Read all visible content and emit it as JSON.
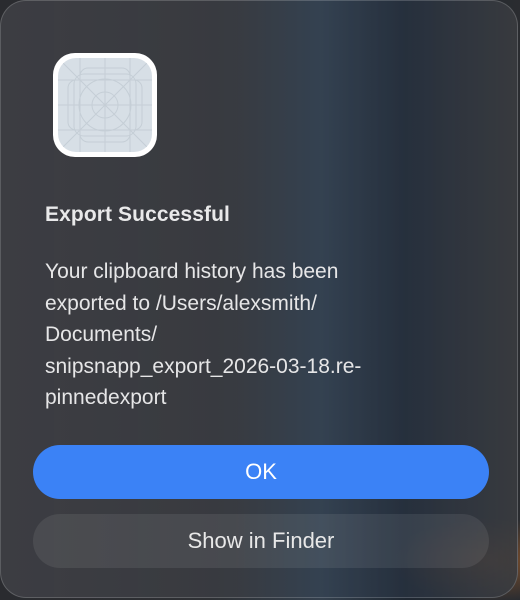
{
  "dialog": {
    "icon": "app-placeholder-icon",
    "title": "Export Successful",
    "message_lines": [
      "Your clipboard history has been",
      "exported to /Users/alexsmith/",
      "Documents/",
      "snipsnapp_export_2026-03-18.re-",
      "pinnedexport"
    ],
    "buttons": {
      "ok_label": "OK",
      "show_in_finder_label": "Show in Finder"
    }
  },
  "colors": {
    "accent": "#3b82f6",
    "dialog_background": "#3c3d42",
    "text": "#e9e9ea"
  }
}
